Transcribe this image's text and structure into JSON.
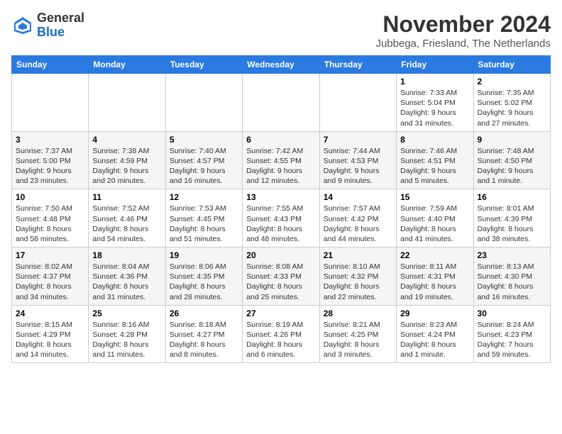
{
  "logo": {
    "general": "General",
    "blue": "Blue"
  },
  "header": {
    "month": "November 2024",
    "location": "Jubbega, Friesland, The Netherlands"
  },
  "weekdays": [
    "Sunday",
    "Monday",
    "Tuesday",
    "Wednesday",
    "Thursday",
    "Friday",
    "Saturday"
  ],
  "weeks": [
    [
      {
        "day": "",
        "info": ""
      },
      {
        "day": "",
        "info": ""
      },
      {
        "day": "",
        "info": ""
      },
      {
        "day": "",
        "info": ""
      },
      {
        "day": "",
        "info": ""
      },
      {
        "day": "1",
        "info": "Sunrise: 7:33 AM\nSunset: 5:04 PM\nDaylight: 9 hours and 31 minutes."
      },
      {
        "day": "2",
        "info": "Sunrise: 7:35 AM\nSunset: 5:02 PM\nDaylight: 9 hours and 27 minutes."
      }
    ],
    [
      {
        "day": "3",
        "info": "Sunrise: 7:37 AM\nSunset: 5:00 PM\nDaylight: 9 hours and 23 minutes."
      },
      {
        "day": "4",
        "info": "Sunrise: 7:38 AM\nSunset: 4:59 PM\nDaylight: 9 hours and 20 minutes."
      },
      {
        "day": "5",
        "info": "Sunrise: 7:40 AM\nSunset: 4:57 PM\nDaylight: 9 hours and 16 minutes."
      },
      {
        "day": "6",
        "info": "Sunrise: 7:42 AM\nSunset: 4:55 PM\nDaylight: 9 hours and 12 minutes."
      },
      {
        "day": "7",
        "info": "Sunrise: 7:44 AM\nSunset: 4:53 PM\nDaylight: 9 hours and 9 minutes."
      },
      {
        "day": "8",
        "info": "Sunrise: 7:46 AM\nSunset: 4:51 PM\nDaylight: 9 hours and 5 minutes."
      },
      {
        "day": "9",
        "info": "Sunrise: 7:48 AM\nSunset: 4:50 PM\nDaylight: 9 hours and 1 minute."
      }
    ],
    [
      {
        "day": "10",
        "info": "Sunrise: 7:50 AM\nSunset: 4:48 PM\nDaylight: 8 hours and 58 minutes."
      },
      {
        "day": "11",
        "info": "Sunrise: 7:52 AM\nSunset: 4:46 PM\nDaylight: 8 hours and 54 minutes."
      },
      {
        "day": "12",
        "info": "Sunrise: 7:53 AM\nSunset: 4:45 PM\nDaylight: 8 hours and 51 minutes."
      },
      {
        "day": "13",
        "info": "Sunrise: 7:55 AM\nSunset: 4:43 PM\nDaylight: 8 hours and 48 minutes."
      },
      {
        "day": "14",
        "info": "Sunrise: 7:57 AM\nSunset: 4:42 PM\nDaylight: 8 hours and 44 minutes."
      },
      {
        "day": "15",
        "info": "Sunrise: 7:59 AM\nSunset: 4:40 PM\nDaylight: 8 hours and 41 minutes."
      },
      {
        "day": "16",
        "info": "Sunrise: 8:01 AM\nSunset: 4:39 PM\nDaylight: 8 hours and 38 minutes."
      }
    ],
    [
      {
        "day": "17",
        "info": "Sunrise: 8:02 AM\nSunset: 4:37 PM\nDaylight: 8 hours and 34 minutes."
      },
      {
        "day": "18",
        "info": "Sunrise: 8:04 AM\nSunset: 4:36 PM\nDaylight: 8 hours and 31 minutes."
      },
      {
        "day": "19",
        "info": "Sunrise: 8:06 AM\nSunset: 4:35 PM\nDaylight: 8 hours and 28 minutes."
      },
      {
        "day": "20",
        "info": "Sunrise: 8:08 AM\nSunset: 4:33 PM\nDaylight: 8 hours and 25 minutes."
      },
      {
        "day": "21",
        "info": "Sunrise: 8:10 AM\nSunset: 4:32 PM\nDaylight: 8 hours and 22 minutes."
      },
      {
        "day": "22",
        "info": "Sunrise: 8:11 AM\nSunset: 4:31 PM\nDaylight: 8 hours and 19 minutes."
      },
      {
        "day": "23",
        "info": "Sunrise: 8:13 AM\nSunset: 4:30 PM\nDaylight: 8 hours and 16 minutes."
      }
    ],
    [
      {
        "day": "24",
        "info": "Sunrise: 8:15 AM\nSunset: 4:29 PM\nDaylight: 8 hours and 14 minutes."
      },
      {
        "day": "25",
        "info": "Sunrise: 8:16 AM\nSunset: 4:28 PM\nDaylight: 8 hours and 11 minutes."
      },
      {
        "day": "26",
        "info": "Sunrise: 8:18 AM\nSunset: 4:27 PM\nDaylight: 8 hours and 8 minutes."
      },
      {
        "day": "27",
        "info": "Sunrise: 8:19 AM\nSunset: 4:26 PM\nDaylight: 8 hours and 6 minutes."
      },
      {
        "day": "28",
        "info": "Sunrise: 8:21 AM\nSunset: 4:25 PM\nDaylight: 8 hours and 3 minutes."
      },
      {
        "day": "29",
        "info": "Sunrise: 8:23 AM\nSunset: 4:24 PM\nDaylight: 8 hours and 1 minute."
      },
      {
        "day": "30",
        "info": "Sunrise: 8:24 AM\nSunset: 4:23 PM\nDaylight: 7 hours and 59 minutes."
      }
    ]
  ]
}
